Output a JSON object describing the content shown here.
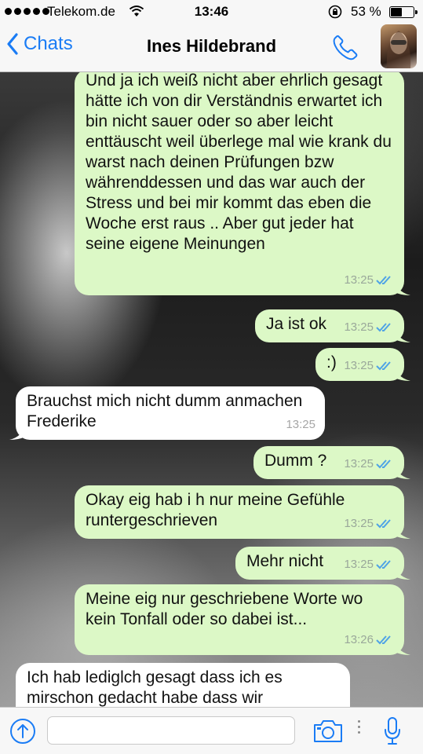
{
  "status_bar": {
    "carrier": "Telekom.de",
    "time": "13:46",
    "battery_percent": "53 %",
    "battery_level": 0.53
  },
  "nav": {
    "back_label": "Chats",
    "contact_name": "Ines Hildebrand"
  },
  "colors": {
    "accent": "#1a7cf5",
    "outgoing_bubble": "#dcf8c6",
    "incoming_bubble": "#ffffff",
    "read_ticks": "#4fa3e6"
  },
  "messages": [
    {
      "direction": "out",
      "text": "Und ja ich weiß nicht aber ehrlich gesagt hätte ich von dir Verständnis erwartet ich bin nicht sauer oder so aber leicht enttäuscht weil überlege mal wie krank du warst nach deinen Prüfungen bzw währenddessen und das war auch der Stress und bei mir kommt das eben die Woche erst raus .. Aber gut jeder hat seine eigene Meinungen",
      "time": "13:25",
      "read": true
    },
    {
      "direction": "out",
      "text": "Ja ist ok",
      "time": "13:25",
      "read": true
    },
    {
      "direction": "out",
      "text": ":)",
      "time": "13:25",
      "read": true
    },
    {
      "direction": "in",
      "text": "Brauchst mich nicht dumm anmachen Frederike",
      "time": "13:25"
    },
    {
      "direction": "out",
      "text": "Dumm ?",
      "time": "13:25",
      "read": true
    },
    {
      "direction": "out",
      "text": "Okay eig hab i h nur meine Gefühle runtergeschrieven",
      "time": "13:25",
      "read": true
    },
    {
      "direction": "out",
      "text": "Mehr nicht",
      "time": "13:25",
      "read": true
    },
    {
      "direction": "out",
      "text": "Meine eig nur geschriebene Worte wo kein Tonfall oder so dabei ist...",
      "time": "13:26",
      "read": true
    },
    {
      "direction": "in",
      "text": "Ich hab lediglch gesagt dass ich es mirschon gedacht habe dass wir",
      "time": ""
    }
  ],
  "input": {
    "placeholder": ""
  },
  "icons": {
    "back": "chevron-left-icon",
    "call": "phone-icon",
    "upload": "upload-arrow-icon",
    "camera": "camera-icon",
    "mic": "microphone-icon"
  }
}
